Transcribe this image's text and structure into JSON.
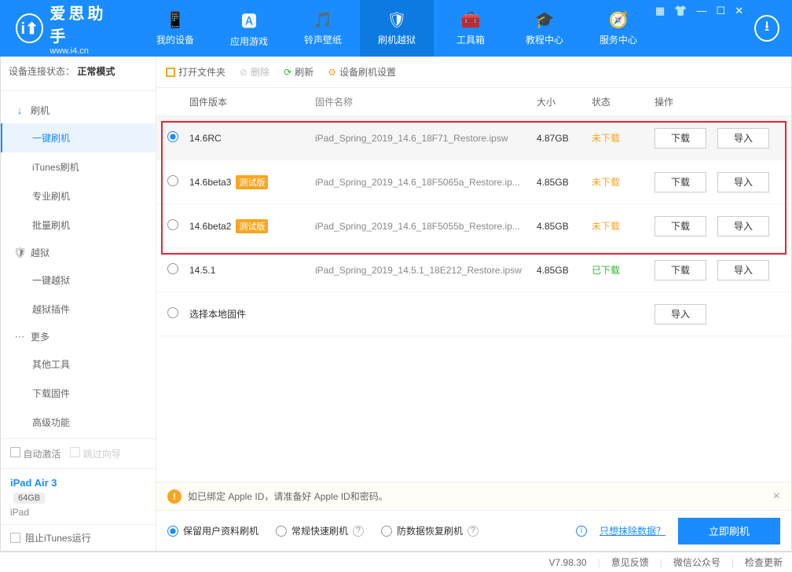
{
  "app": {
    "title": "爱思助手",
    "subtitle": "www.i4.cn"
  },
  "nav": {
    "items": [
      {
        "icon": "📱",
        "label": "我的设备"
      },
      {
        "icon": "🅰",
        "label": "应用游戏"
      },
      {
        "icon": "🎵",
        "label": "铃声壁纸"
      },
      {
        "icon": "🛡",
        "label": "刷机越狱"
      },
      {
        "icon": "🧰",
        "label": "工具箱"
      },
      {
        "icon": "🎓",
        "label": "教程中心"
      },
      {
        "icon": "🧭",
        "label": "服务中心"
      }
    ],
    "active_index": 3
  },
  "connection": {
    "label": "设备连接状态：",
    "value": "正常模式"
  },
  "sidebar": {
    "groups": [
      {
        "icon": "↓",
        "icon_color": "#1a8cff",
        "label": "刷机",
        "items": [
          "一键刷机",
          "iTunes刷机",
          "专业刷机",
          "批量刷机"
        ],
        "active_index": 0
      },
      {
        "icon": "🛡",
        "icon_color": "#888",
        "label": "越狱",
        "items": [
          "一键越狱",
          "越狱插件"
        ],
        "active_index": -1
      },
      {
        "icon": "⋯",
        "icon_color": "#888",
        "label": "更多",
        "items": [
          "其他工具",
          "下载固件",
          "高级功能"
        ],
        "active_index": -1
      }
    ],
    "auto_activate": "自动激活",
    "skip_wizard": "跳过向导"
  },
  "device": {
    "name": "iPad Air 3",
    "storage": "64GB",
    "model": "iPad"
  },
  "itunes_block": "阻止iTunes运行",
  "toolbar": {
    "open": "打开文件夹",
    "delete": "删除",
    "refresh": "刷新",
    "settings": "设备刷机设置"
  },
  "table": {
    "headers": {
      "version": "固件版本",
      "name": "固件名称",
      "size": "大小",
      "status": "状态",
      "ops": "操作"
    },
    "beta_label": "测试版",
    "dl_btn": "下载",
    "import_btn": "导入",
    "rows": [
      {
        "selected": true,
        "version": "14.6RC",
        "beta": false,
        "name": "iPad_Spring_2019_14.6_18F71_Restore.ipsw",
        "size": "4.87GB",
        "status": "未下载",
        "status_cls": "st-und",
        "has_dl": true,
        "has_imp": true
      },
      {
        "selected": false,
        "version": "14.6beta3",
        "beta": true,
        "name": "iPad_Spring_2019_14.6_18F5065a_Restore.ip...",
        "size": "4.85GB",
        "status": "未下载",
        "status_cls": "st-und",
        "has_dl": true,
        "has_imp": true
      },
      {
        "selected": false,
        "version": "14.6beta2",
        "beta": true,
        "name": "iPad_Spring_2019_14.6_18F5055b_Restore.ip...",
        "size": "4.85GB",
        "status": "未下载",
        "status_cls": "st-und",
        "has_dl": true,
        "has_imp": true
      },
      {
        "selected": false,
        "version": "14.5.1",
        "beta": false,
        "name": "iPad_Spring_2019_14.5.1_18E212_Restore.ipsw",
        "size": "4.85GB",
        "status": "已下载",
        "status_cls": "st-done",
        "has_dl": true,
        "has_imp": true
      },
      {
        "selected": false,
        "version": "选择本地固件",
        "beta": false,
        "name": "",
        "size": "",
        "status": "",
        "status_cls": "",
        "has_dl": false,
        "has_imp": true
      }
    ]
  },
  "warning": "如已绑定 Apple ID，请准备好 Apple ID和密码。",
  "options": {
    "items": [
      {
        "label": "保留用户资料刷机",
        "on": true
      },
      {
        "label": "常规快速刷机",
        "on": false
      },
      {
        "label": "防数据恢复刷机",
        "on": false
      }
    ],
    "erase_link": "只想抹除数据？",
    "go": "立即刷机"
  },
  "footer": {
    "version": "V7.98.30",
    "feedback": "意见反馈",
    "wechat": "微信公众号",
    "update": "检查更新"
  }
}
